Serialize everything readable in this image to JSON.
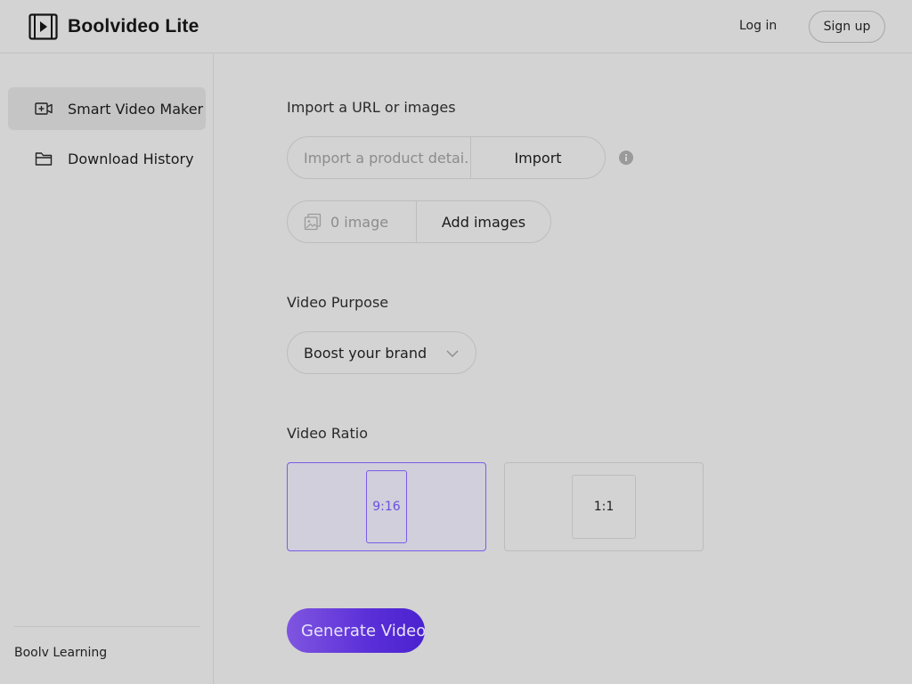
{
  "header": {
    "app_name": "Boolvideo Lite",
    "login_label": "Log in",
    "signup_label": "Sign up"
  },
  "sidebar": {
    "items": [
      {
        "label": "Smart Video Maker",
        "icon": "video-add-icon",
        "active": true
      },
      {
        "label": "Download History",
        "icon": "folder-icon",
        "active": false
      }
    ],
    "footer_label": "Boolv Learning"
  },
  "main": {
    "import_section_label": "Import a URL or images",
    "url_placeholder": "Import a product detai...",
    "import_label": "Import",
    "image_count": "0 image",
    "add_images_label": "Add images",
    "purpose_section_label": "Video Purpose",
    "purpose_value": "Boost your brand",
    "ratio_section_label": "Video Ratio",
    "ratios": [
      {
        "label": "9:16",
        "selected": true
      },
      {
        "label": "1:1",
        "selected": false
      }
    ],
    "generate_label": "Generate Video"
  },
  "colors": {
    "accent": "#6a4fe0",
    "background": "#d3d3d3",
    "button_gradient_start": "#7f55e0",
    "button_gradient_end": "#4a22cf"
  }
}
